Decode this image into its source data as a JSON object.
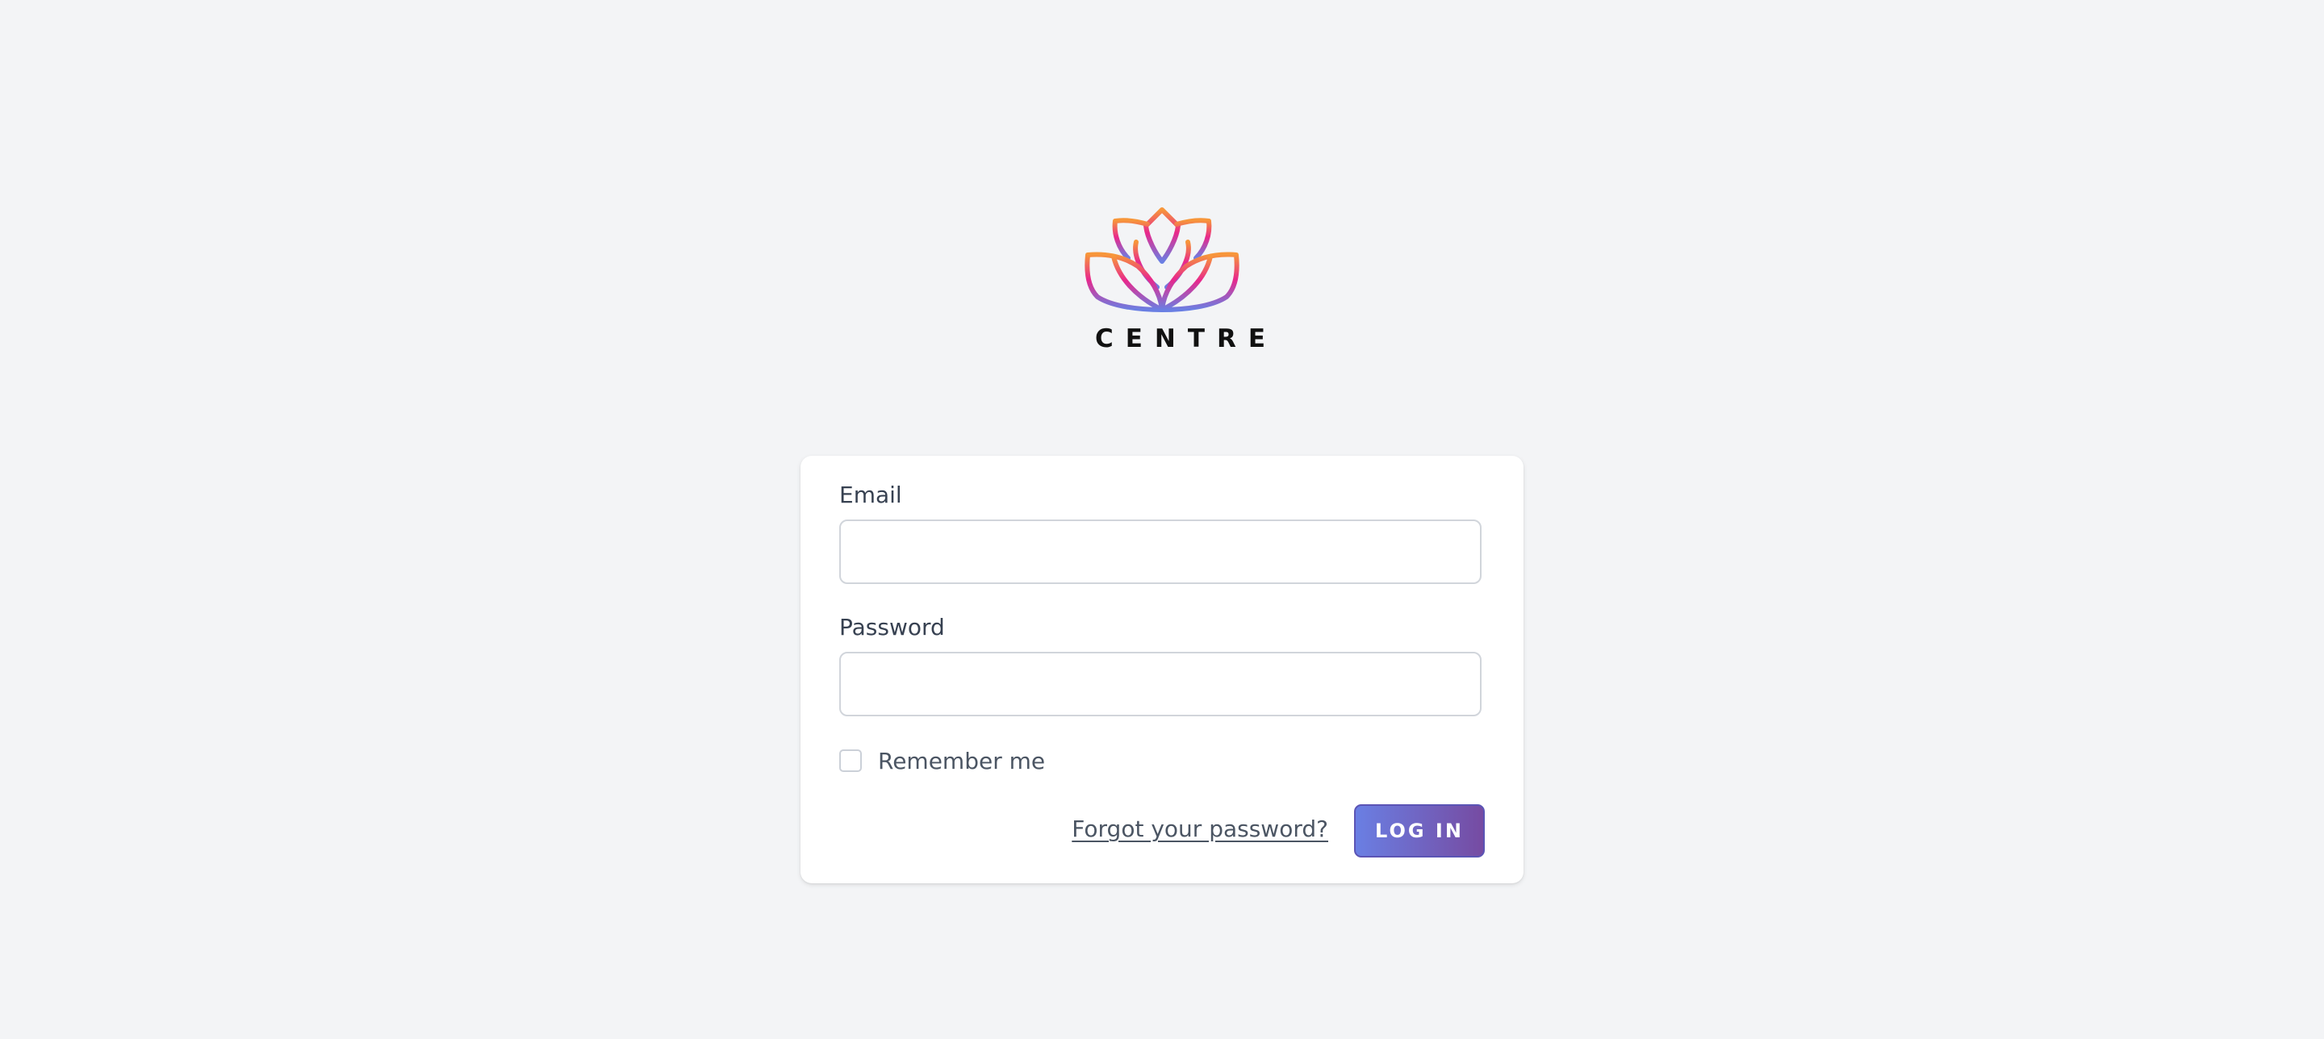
{
  "brand": {
    "name": "CENTRE",
    "logo_icon": "lotus-icon",
    "gradient_colors": [
      "#f7963a",
      "#e8288c",
      "#6a7fe3"
    ]
  },
  "form": {
    "email_label": "Email",
    "email_value": "",
    "password_label": "Password",
    "password_value": "",
    "remember_label": "Remember me",
    "remember_checked": false,
    "forgot_link": "Forgot your password?",
    "login_button": "LOG IN"
  },
  "colors": {
    "background": "#f3f4f6",
    "card": "#ffffff",
    "button_gradient_start": "#6a7fe3",
    "button_gradient_end": "#764ba2"
  }
}
